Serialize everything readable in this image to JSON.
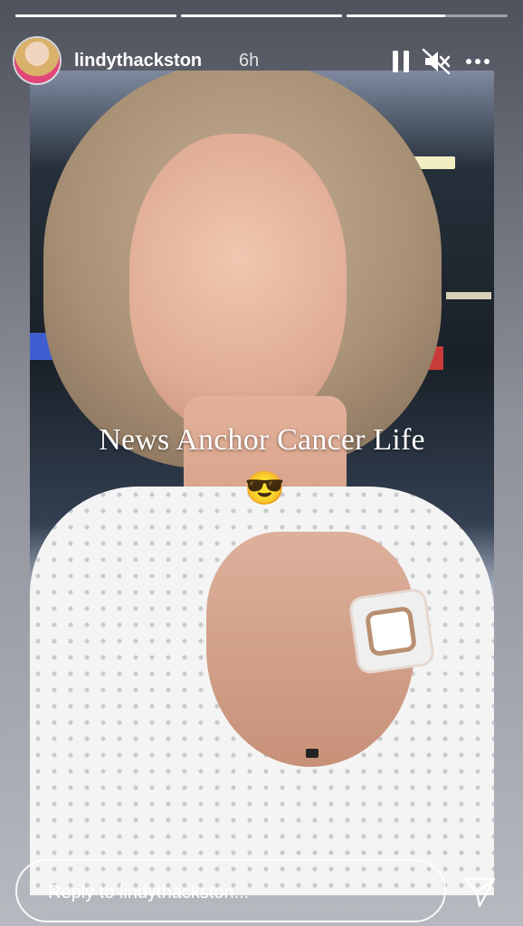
{
  "story": {
    "progress_bars": [
      1,
      1,
      0.61
    ],
    "username": "lindythackston",
    "time_ago": "6h",
    "caption": "News Anchor Cancer Life",
    "emoji": "😎"
  },
  "controls": {
    "pause_icon": "pause-icon",
    "mute_icon": "muted-speaker-icon",
    "more_icon": "more-options-icon",
    "send_icon": "send-icon"
  },
  "reply": {
    "placeholder": "Reply to lindythackston..."
  }
}
